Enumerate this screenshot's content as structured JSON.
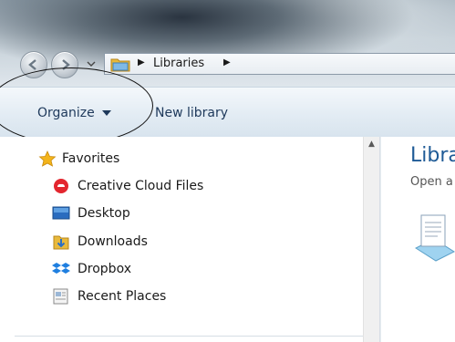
{
  "address": {
    "crumb": "Libraries"
  },
  "toolbar": {
    "organize_label": "Organize",
    "new_library_label": "New library"
  },
  "nav": {
    "favorites_label": "Favorites",
    "items": [
      {
        "label": "Creative Cloud Files",
        "icon": "creative-cloud-icon"
      },
      {
        "label": "Desktop",
        "icon": "desktop-icon"
      },
      {
        "label": "Downloads",
        "icon": "downloads-icon"
      },
      {
        "label": "Dropbox",
        "icon": "dropbox-icon"
      },
      {
        "label": "Recent Places",
        "icon": "recent-places-icon"
      }
    ]
  },
  "content": {
    "title": "Libra",
    "subtitle": "Open a"
  },
  "colors": {
    "link_text": "#1e395b",
    "library_title": "#1e5a96",
    "annotation_ink": "#111111"
  }
}
